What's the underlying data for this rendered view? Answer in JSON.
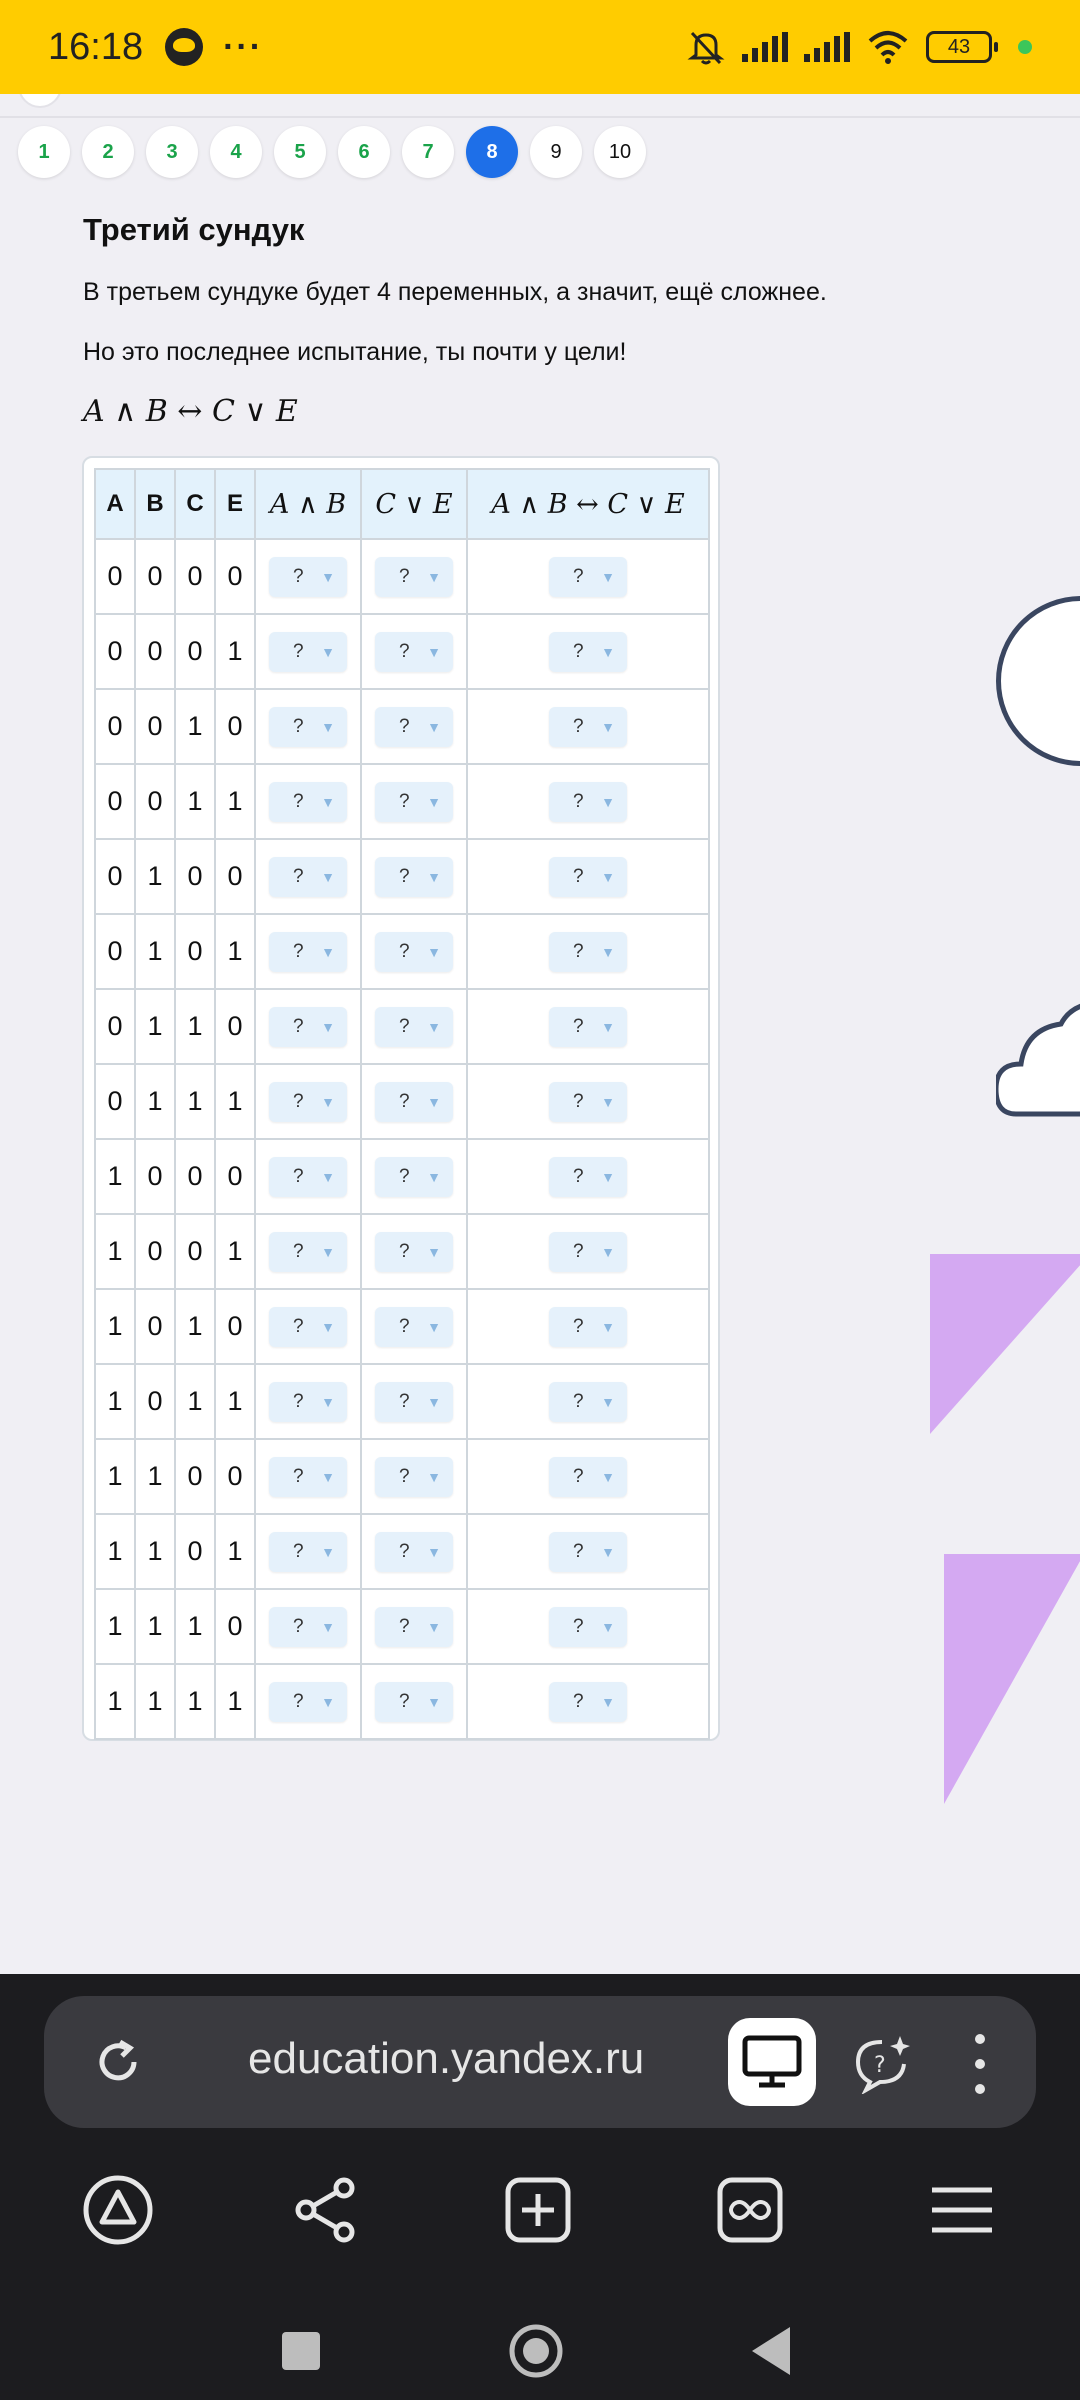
{
  "status_bar": {
    "time": "16:18",
    "dots": "···",
    "battery": "43"
  },
  "pager": [
    "1",
    "2",
    "3",
    "4",
    "5",
    "6",
    "7",
    "8",
    "9",
    "10"
  ],
  "content": {
    "title": "Третий сундук",
    "paragraph1": "В третьем сундуке будет 4 переменных, а значит, ещё сложнее.",
    "paragraph2": "Но это последнее испытание, ты почти у цели!",
    "formula": "A ∧ B ↔ C ∨ E"
  },
  "table": {
    "headers": [
      "A",
      "B",
      "C",
      "E",
      "A ∧ B",
      "C ∨ E",
      "A ∧ B ↔ C ∨ E"
    ],
    "rows": [
      [
        "0",
        "0",
        "0",
        "0"
      ],
      [
        "0",
        "0",
        "0",
        "1"
      ],
      [
        "0",
        "0",
        "1",
        "0"
      ],
      [
        "0",
        "0",
        "1",
        "1"
      ],
      [
        "0",
        "1",
        "0",
        "0"
      ],
      [
        "0",
        "1",
        "0",
        "1"
      ],
      [
        "0",
        "1",
        "1",
        "0"
      ],
      [
        "0",
        "1",
        "1",
        "1"
      ],
      [
        "1",
        "0",
        "0",
        "0"
      ],
      [
        "1",
        "0",
        "0",
        "1"
      ],
      [
        "1",
        "0",
        "1",
        "0"
      ],
      [
        "1",
        "0",
        "1",
        "1"
      ],
      [
        "1",
        "1",
        "0",
        "0"
      ],
      [
        "1",
        "1",
        "0",
        "1"
      ],
      [
        "1",
        "1",
        "1",
        "0"
      ],
      [
        "1",
        "1",
        "1",
        "1"
      ]
    ],
    "dropdown_value": "?"
  },
  "browser": {
    "url": "education.yandex.ru"
  },
  "colors": {
    "status_bar": "#ffcc00",
    "current_page": "#1e6fe8",
    "page_link": "#1aa34a",
    "header_bg": "#e3f2fc"
  }
}
